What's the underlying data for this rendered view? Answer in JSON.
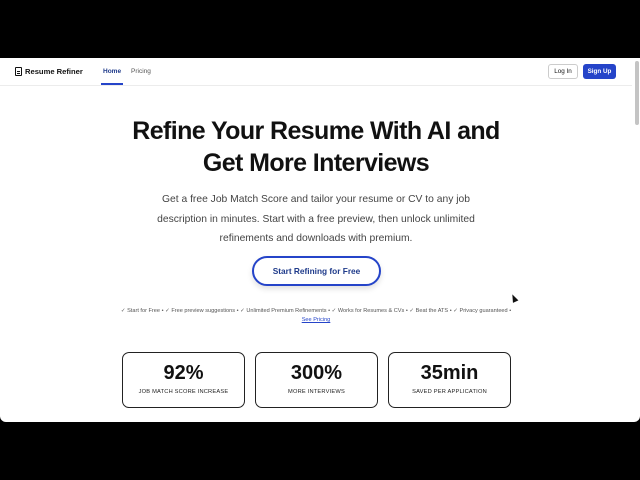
{
  "nav": {
    "logo_text": "Resume Refiner",
    "links": [
      "Home",
      "Pricing"
    ],
    "login_label": "Log In",
    "signup_label": "Sign Up"
  },
  "hero": {
    "title_line1": "Refine Your Resume With AI and",
    "title_line2": "Get More Interviews",
    "subtitle": "Get a free Job Match Score and tailor your resume or CV to any job description in minutes. Start with a free preview, then unlock unlimited refinements and downloads with premium.",
    "cta_label": "Start Refining for Free"
  },
  "features": {
    "text": "✓ Start for Free • ✓ Free preview suggestions • ✓ Unlimited Premium Refinements • ✓ Works for Resumes & CVs • ✓ Beat the ATS • ✓ Privacy guaranteed •",
    "link_label": "See Pricing"
  },
  "stats": [
    {
      "value": "92%",
      "label": "JOB MATCH SCORE INCREASE"
    },
    {
      "value": "300%",
      "label": "MORE INTERVIEWS"
    },
    {
      "value": "35min",
      "label": "SAVED PER APPLICATION"
    }
  ],
  "colors": {
    "accent": "#2544c9",
    "text": "#111111",
    "background": "#ffffff"
  }
}
